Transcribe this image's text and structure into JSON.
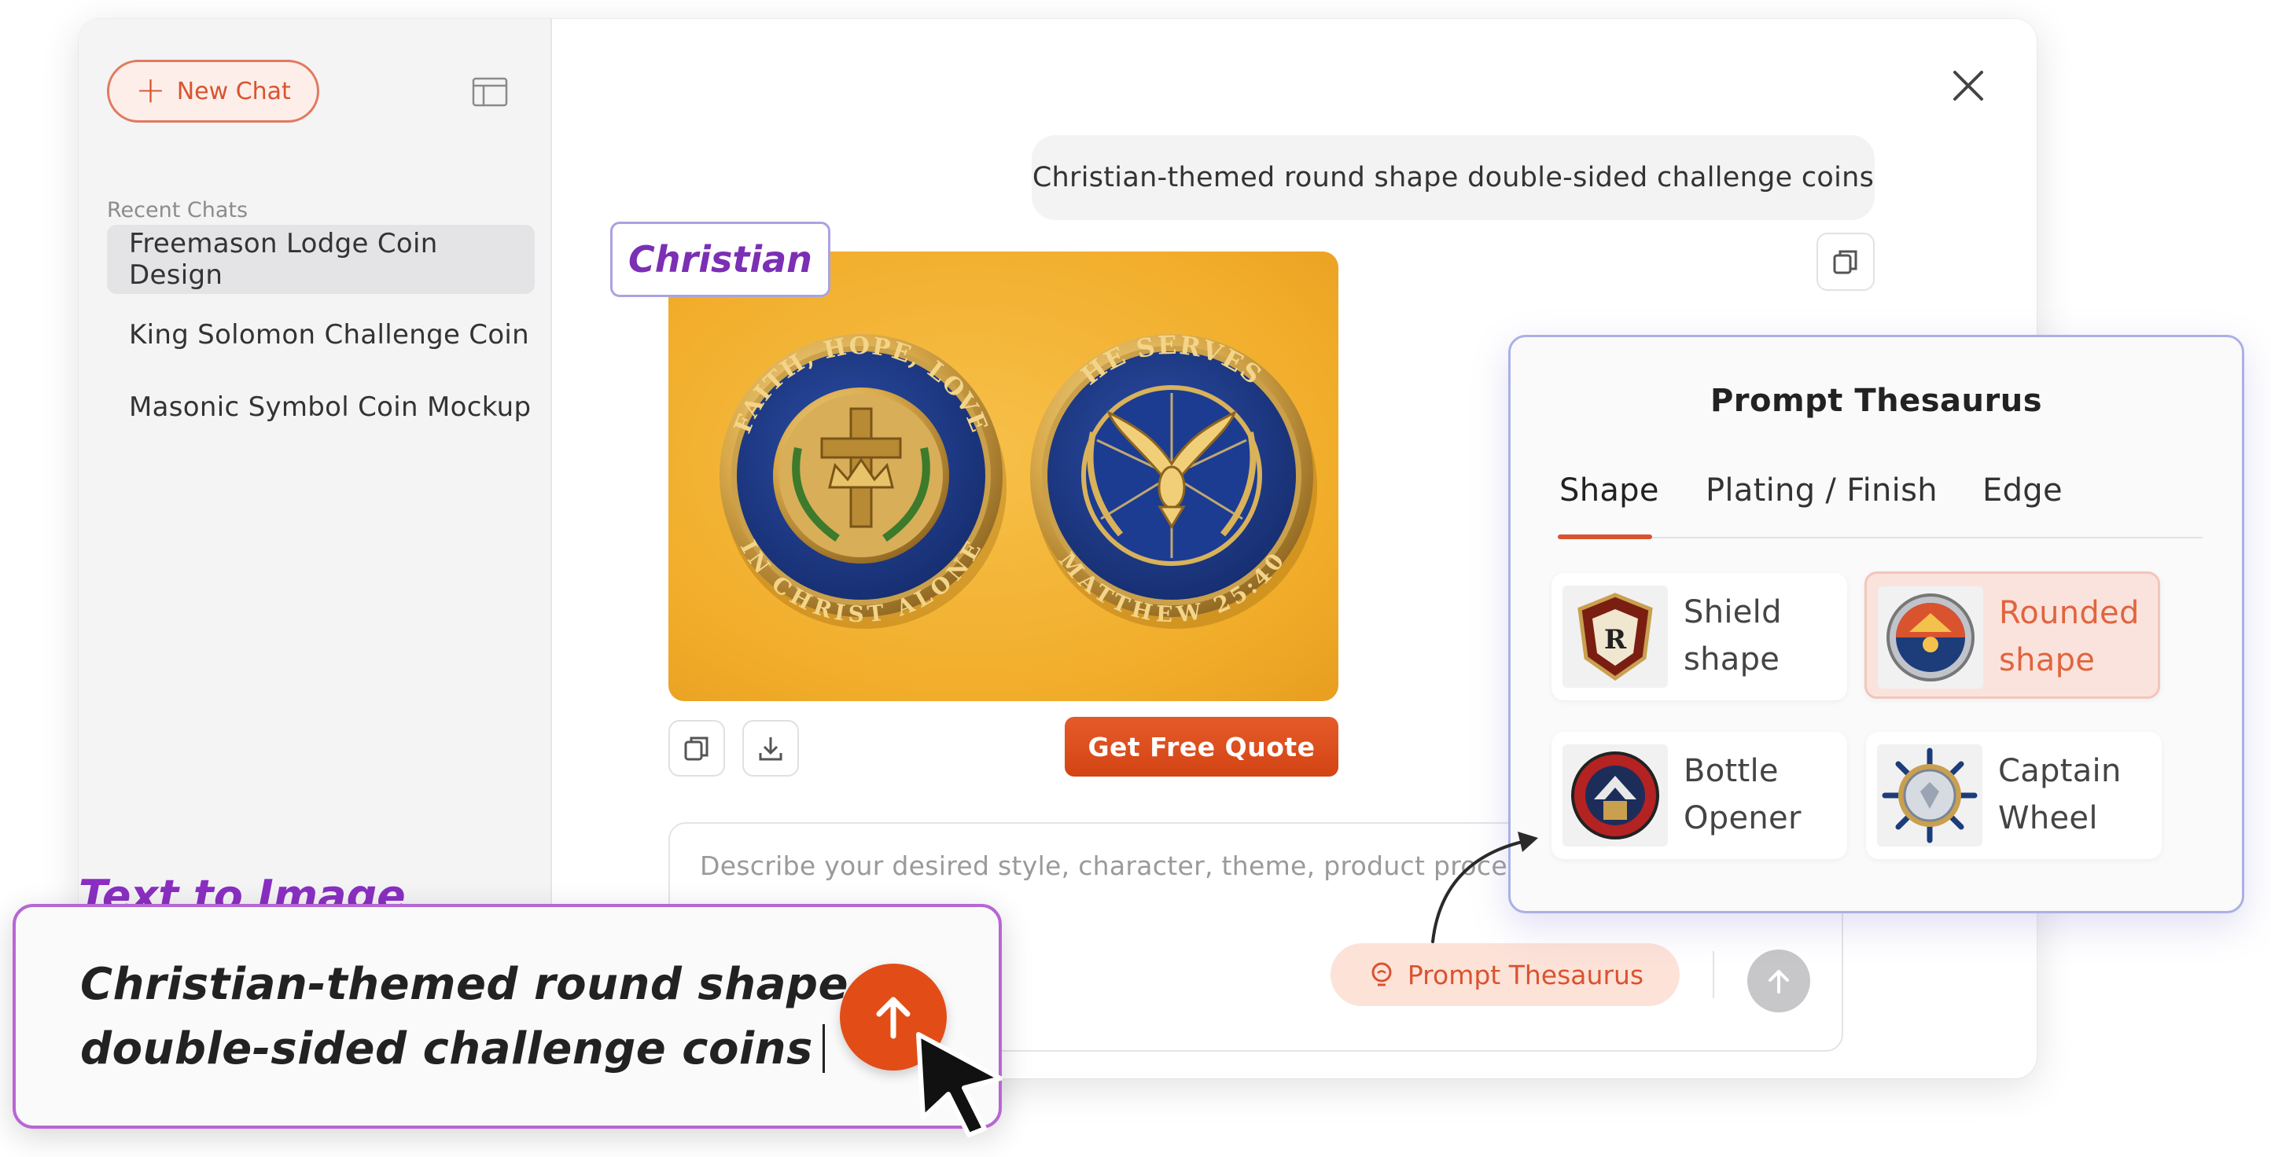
{
  "sidebar": {
    "new_chat_label": "New Chat",
    "recent_label": "Recent Chats",
    "items": [
      {
        "label": "Freemason Lodge Coin Design",
        "active": true
      },
      {
        "label": "King Solomon Challenge Coin",
        "active": false
      },
      {
        "label": "Masonic Symbol Coin Mockup",
        "active": false
      }
    ]
  },
  "chat": {
    "user_message": "Christian-themed round shape double-sided challenge coins",
    "image_tag": "Christian",
    "coin_left": {
      "top_text": "FAITH, HOPE, LOVE",
      "bottom_text": "IN CHRIST ALONE"
    },
    "coin_right": {
      "top_text": "HE SERVES",
      "bottom_text": "MATTHEW 25:40"
    },
    "quote_button": "Get Free Quote"
  },
  "composer": {
    "placeholder": "Describe your desired style, character, theme, product process...",
    "prompt_thesaurus_label": "Prompt Thesaurus"
  },
  "thesaurus": {
    "title": "Prompt Thesaurus",
    "tabs": [
      "Shape",
      "Plating / Finish",
      "Edge"
    ],
    "active_tab": "Shape",
    "options": [
      {
        "line1": "Shield",
        "line2": "shape",
        "selected": false,
        "icon": "shield-coin-icon"
      },
      {
        "line1": "Rounded",
        "line2": "shape",
        "selected": true,
        "icon": "round-coin-icon"
      },
      {
        "line1": "Bottle",
        "line2": "Opener",
        "selected": false,
        "icon": "bottle-opener-coin-icon"
      },
      {
        "line1": "Captain",
        "line2": "Wheel",
        "selected": false,
        "icon": "captain-wheel-coin-icon"
      }
    ]
  },
  "callout": {
    "title": "Text to Image",
    "line1": "Christian-themed round shape",
    "line2": "double-sided challenge coins"
  },
  "colors": {
    "accent": "#d9532f",
    "send": "#e24d17",
    "coin_bg": "#f1ad2a",
    "coin_blue": "#1f3a8a",
    "coin_gold": "#d9b25a",
    "purple": "#8a2fc2"
  }
}
